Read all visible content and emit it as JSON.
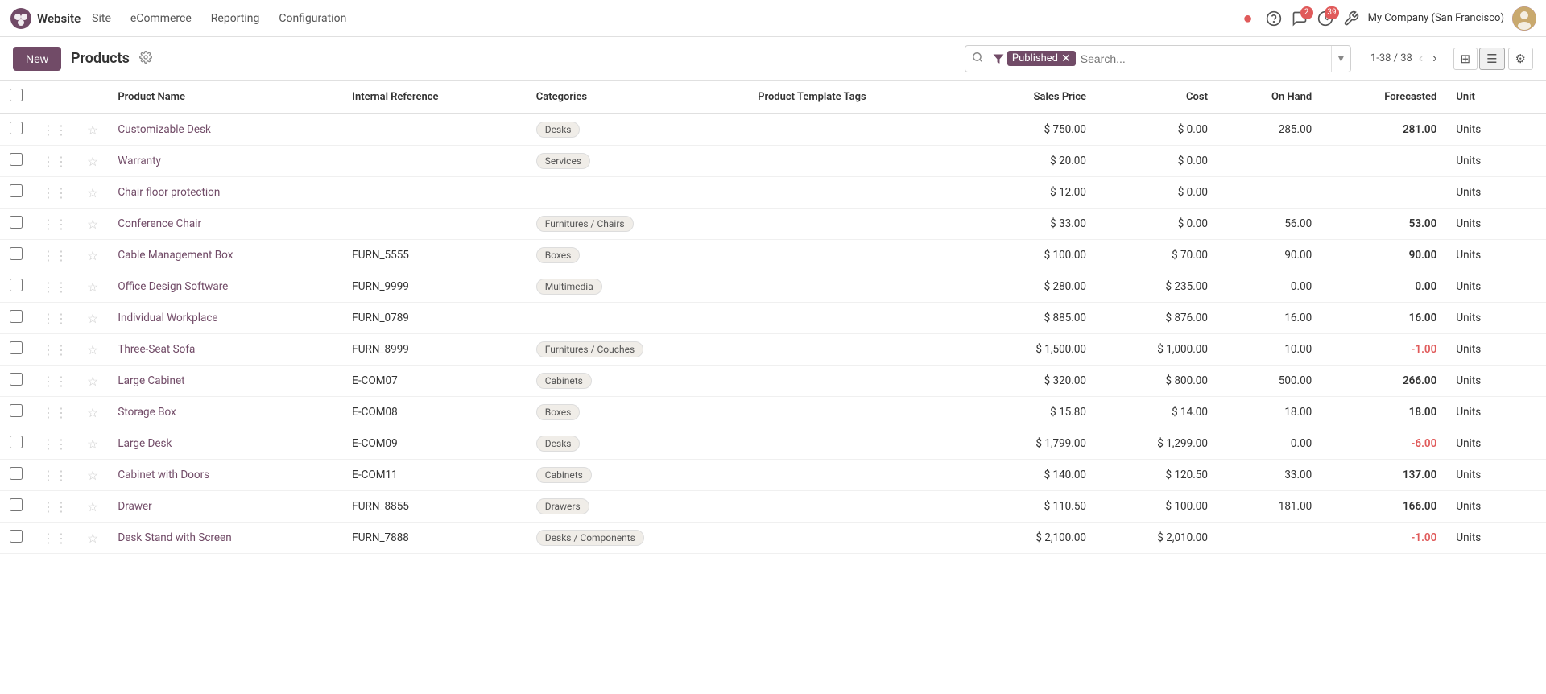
{
  "app": {
    "logo_text": "●",
    "brand": "Website",
    "nav_items": [
      "Site",
      "eCommerce",
      "Reporting",
      "Configuration"
    ]
  },
  "nav_icons": {
    "dot_red": "●",
    "headset": "🎧",
    "chat_badge": "2",
    "clock_badge": "39",
    "wrench": "🔧",
    "company": "My Company (San Francisco)"
  },
  "toolbar": {
    "new_label": "New",
    "page_title": "Products",
    "pagination": "1-38 / 38",
    "search_placeholder": "Search...",
    "filter_label": "Published"
  },
  "table": {
    "headers": [
      "Product Name",
      "Internal Reference",
      "Categories",
      "Product Template Tags",
      "Sales Price",
      "Cost",
      "On Hand",
      "Forecasted",
      "Unit"
    ],
    "rows": [
      {
        "name": "Customizable Desk",
        "ref": "",
        "categories": "Desks",
        "tags": "",
        "sales_price": "$ 750.00",
        "cost": "$ 0.00",
        "on_hand": "285.00",
        "forecasted": "281.00",
        "unit": "Units",
        "forecasted_neg": false
      },
      {
        "name": "Warranty",
        "ref": "",
        "categories": "Services",
        "tags": "",
        "sales_price": "$ 20.00",
        "cost": "$ 0.00",
        "on_hand": "",
        "forecasted": "",
        "unit": "Units",
        "forecasted_neg": false
      },
      {
        "name": "Chair floor protection",
        "ref": "",
        "categories": "",
        "tags": "",
        "sales_price": "$ 12.00",
        "cost": "$ 0.00",
        "on_hand": "",
        "forecasted": "",
        "unit": "Units",
        "forecasted_neg": false
      },
      {
        "name": "Conference Chair",
        "ref": "",
        "categories": "Furnitures / Chairs",
        "tags": "",
        "sales_price": "$ 33.00",
        "cost": "$ 0.00",
        "on_hand": "56.00",
        "forecasted": "53.00",
        "unit": "Units",
        "forecasted_neg": false
      },
      {
        "name": "Cable Management Box",
        "ref": "FURN_5555",
        "categories": "Boxes",
        "tags": "",
        "sales_price": "$ 100.00",
        "cost": "$ 70.00",
        "on_hand": "90.00",
        "forecasted": "90.00",
        "unit": "Units",
        "forecasted_neg": false
      },
      {
        "name": "Office Design Software",
        "ref": "FURN_9999",
        "categories": "Multimedia",
        "tags": "",
        "sales_price": "$ 280.00",
        "cost": "$ 235.00",
        "on_hand": "0.00",
        "forecasted": "0.00",
        "unit": "Units",
        "forecasted_neg": false
      },
      {
        "name": "Individual Workplace",
        "ref": "FURN_0789",
        "categories": "",
        "tags": "",
        "sales_price": "$ 885.00",
        "cost": "$ 876.00",
        "on_hand": "16.00",
        "forecasted": "16.00",
        "unit": "Units",
        "forecasted_neg": false
      },
      {
        "name": "Three-Seat Sofa",
        "ref": "FURN_8999",
        "categories": "Furnitures / Couches",
        "tags": "",
        "sales_price": "$ 1,500.00",
        "cost": "$ 1,000.00",
        "on_hand": "10.00",
        "forecasted": "-1.00",
        "unit": "Units",
        "forecasted_neg": true
      },
      {
        "name": "Large Cabinet",
        "ref": "E-COM07",
        "categories": "Cabinets",
        "tags": "",
        "sales_price": "$ 320.00",
        "cost": "$ 800.00",
        "on_hand": "500.00",
        "forecasted": "266.00",
        "unit": "Units",
        "forecasted_neg": false
      },
      {
        "name": "Storage Box",
        "ref": "E-COM08",
        "categories": "Boxes",
        "tags": "",
        "sales_price": "$ 15.80",
        "cost": "$ 14.00",
        "on_hand": "18.00",
        "forecasted": "18.00",
        "unit": "Units",
        "forecasted_neg": false
      },
      {
        "name": "Large Desk",
        "ref": "E-COM09",
        "categories": "Desks",
        "tags": "",
        "sales_price": "$ 1,799.00",
        "cost": "$ 1,299.00",
        "on_hand": "0.00",
        "forecasted": "-6.00",
        "unit": "Units",
        "forecasted_neg": true
      },
      {
        "name": "Cabinet with Doors",
        "ref": "E-COM11",
        "categories": "Cabinets",
        "tags": "",
        "sales_price": "$ 140.00",
        "cost": "$ 120.50",
        "on_hand": "33.00",
        "forecasted": "137.00",
        "unit": "Units",
        "forecasted_neg": false
      },
      {
        "name": "Drawer",
        "ref": "FURN_8855",
        "categories": "Drawers",
        "tags": "",
        "sales_price": "$ 110.50",
        "cost": "$ 100.00",
        "on_hand": "181.00",
        "forecasted": "166.00",
        "unit": "Units",
        "forecasted_neg": false
      },
      {
        "name": "Desk Stand with Screen",
        "ref": "FURN_7888",
        "categories": "Desks / Components",
        "tags": "",
        "sales_price": "$ 2,100.00",
        "cost": "$ 2,010.00",
        "on_hand": "",
        "forecasted": "-1.00",
        "unit": "Units",
        "forecasted_neg": true
      }
    ]
  }
}
